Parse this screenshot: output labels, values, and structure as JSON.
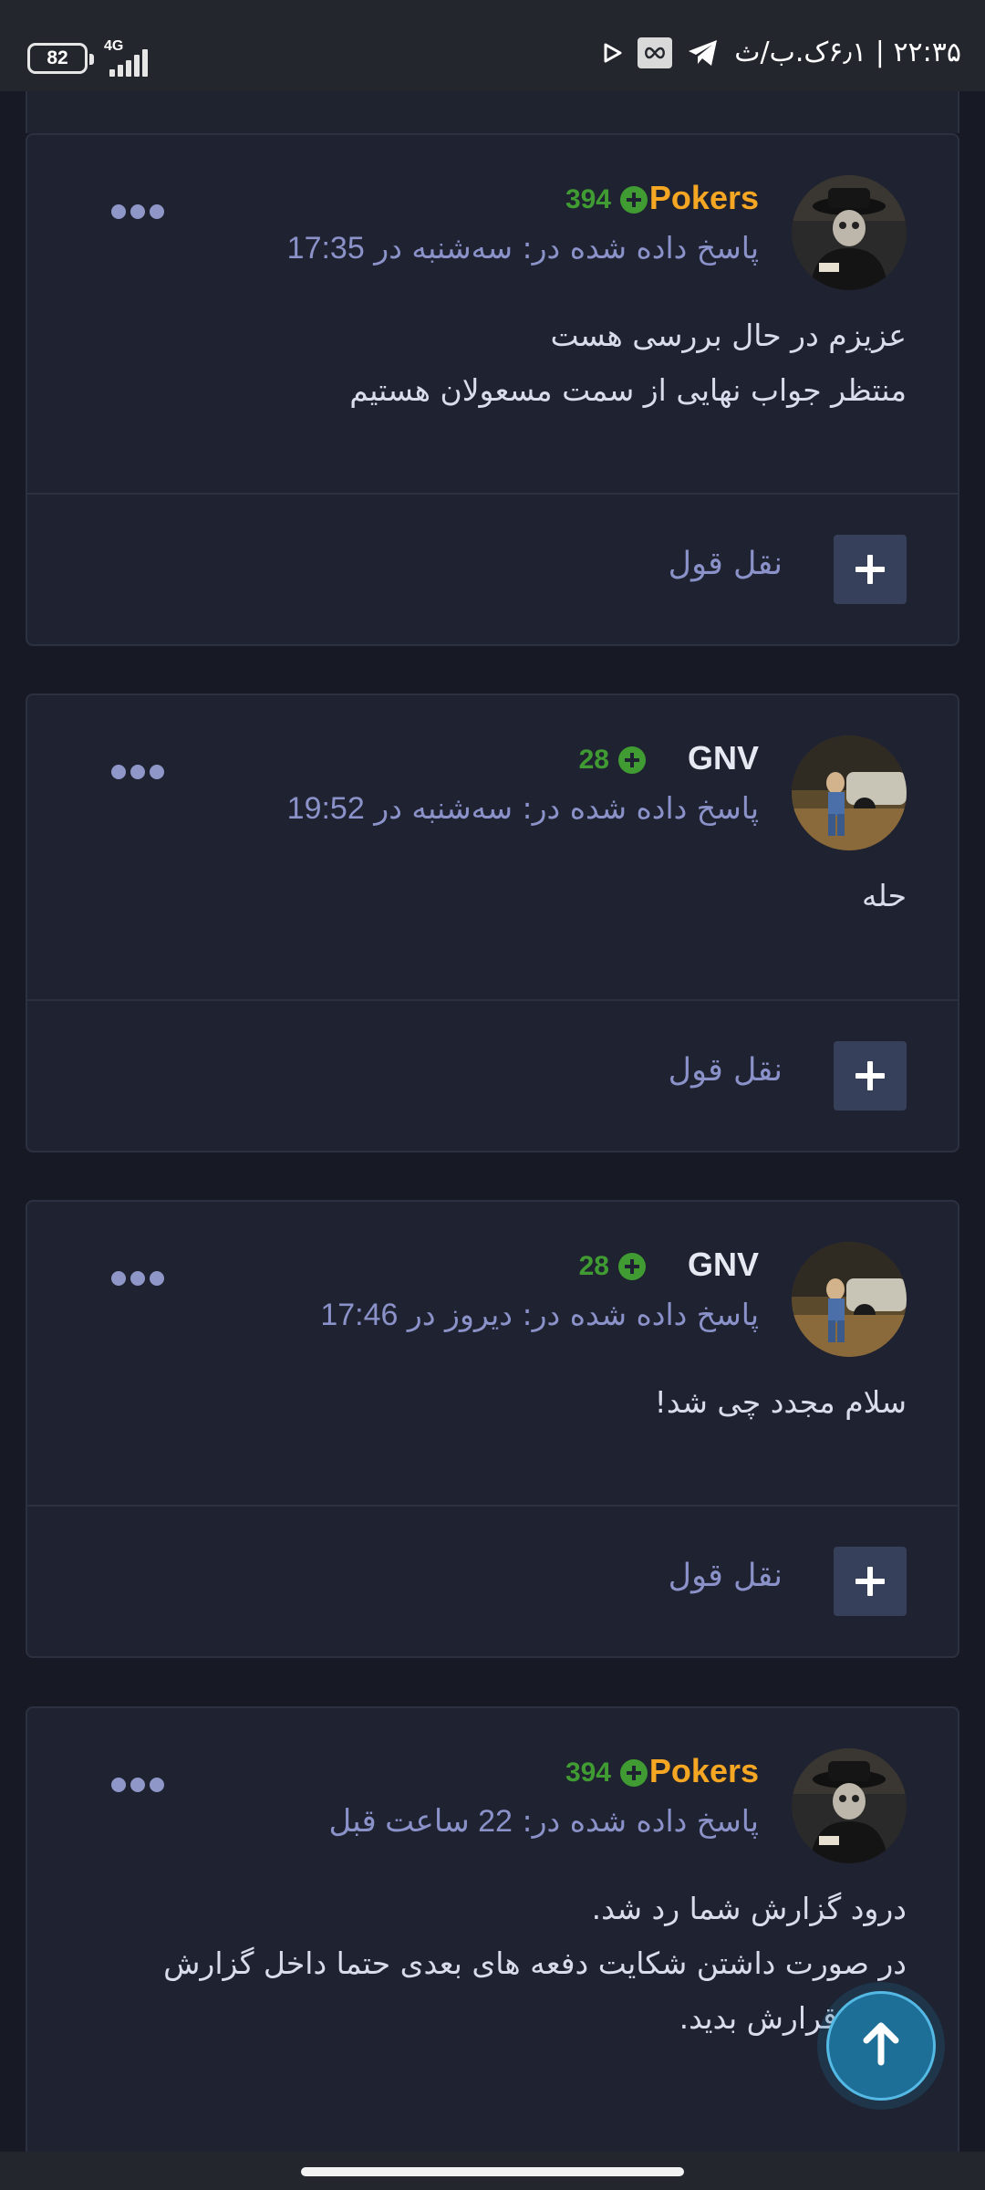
{
  "status_bar": {
    "battery": "82",
    "network": "4G",
    "time_text": "۲۲:۳۵ | ۶٫۱ک.ب/ث"
  },
  "colors": {
    "accent_orange": "#f5a623",
    "username_white": "#e6e8f2",
    "reputation_green": "#3f9b32",
    "meta_lavender": "#8a92c9",
    "card_bg": "#1f2230",
    "scroll_top_blue": "#1d6f98"
  },
  "icons": {
    "reputation": "plus-circle-icon",
    "menu": "more-dots-icon",
    "quote": "plus-icon",
    "scroll_top": "arrow-up-icon"
  },
  "posts": [
    {
      "username": "Pokers",
      "username_color": "#f5a623",
      "reputation": "394",
      "meta_prefix": "پاسخ داده شده در: سه‌شنبه در",
      "meta_time": "17:35",
      "body": [
        "عزیزم در حال بررسی هست",
        "منتظر جواب نهایی از سمت مسعولان هستیم"
      ],
      "quote_label": "نقل قول"
    },
    {
      "username": "GNV",
      "username_color": "#e6e8f2",
      "reputation": "28",
      "meta_prefix": "پاسخ داده شده در: سه‌شنبه در",
      "meta_time": "19:52",
      "body": [
        "حله"
      ],
      "quote_label": "نقل قول"
    },
    {
      "username": "GNV",
      "username_color": "#e6e8f2",
      "reputation": "28",
      "meta_prefix": "پاسخ داده شده در: دیروز در",
      "meta_time": "17:46",
      "body": [
        "سلام مجدد چی شد!"
      ],
      "quote_label": "نقل قول"
    },
    {
      "username": "Pokers",
      "username_color": "#f5a623",
      "reputation": "394",
      "meta_prefix": "پاسخ داده شده در:",
      "meta_time": "22 ساعت قبل",
      "body": [
        "درود گزارش شما رد شد.",
        "در صورت داشتن شکایت دفعه های بعدی حتما داخل گزارش",
        "امضا قرارش بدید."
      ],
      "quote_label": ""
    }
  ]
}
